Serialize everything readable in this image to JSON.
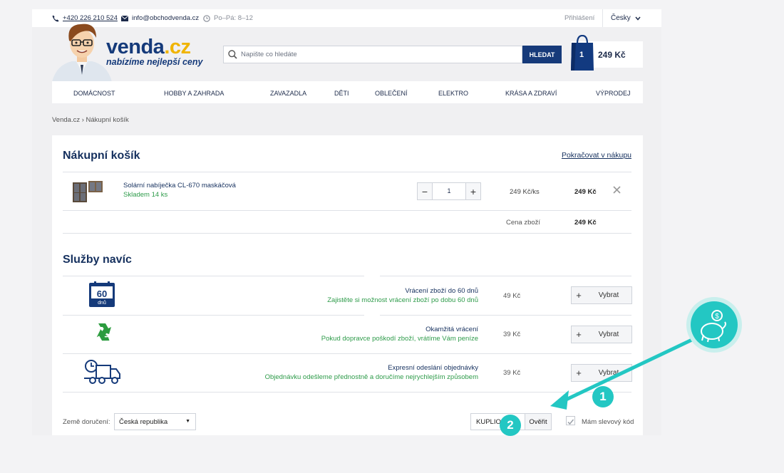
{
  "topbar": {
    "phone": "+420 226 210 524",
    "email": "info@obchodvenda.cz",
    "hours": "Po–Pá: 8–12",
    "login": "Přihlášení",
    "language": "Česky"
  },
  "brand": {
    "name": "venda",
    "tld": ".cz",
    "slogan": "nabízíme nejlepší ceny"
  },
  "search": {
    "placeholder": "Napište co hledáte",
    "button": "HLEDAT"
  },
  "cart": {
    "count": "1",
    "total": "249 Kč"
  },
  "nav": [
    "DOMÁCNOST",
    "HOBBY A ZAHRADA",
    "ZAVAZADLA",
    "DĚTI",
    "OBLEČENÍ",
    "ELEKTRO",
    "KRÁSA A ZDRAVÍ",
    "VÝPRODEJ"
  ],
  "breadcrumb": "Venda.cz › Nákupní košík",
  "basket": {
    "title": "Nákupní košík",
    "continue": "Pokračovat v nákupu",
    "item": {
      "name": "Solární nabíječka CL-670 maskáčová",
      "stock": "Skladem 14 ks",
      "qty": "1",
      "unit_price": "249 Kč/ks",
      "price": "249 Kč"
    },
    "subtotal_label": "Cena zboží",
    "subtotal_value": "249 Kč"
  },
  "services": {
    "title": "Služby navíc",
    "button": "Vybrat",
    "items": [
      {
        "icon": "calendar-60-icon",
        "icon_big": "60",
        "icon_small": "dnů",
        "title": "Vrácení zboží do 60 dnů",
        "desc": "Zajistěte si možnost vrácení zboží po dobu 60 dnů",
        "price": "49 Kč"
      },
      {
        "icon": "recycle-icon",
        "title": "Okamžitá vrácení",
        "desc": "Pokud dopravce poškodí zboží, vrátíme Vám peníze",
        "price": "39 Kč"
      },
      {
        "icon": "delivery-truck-icon",
        "title": "Expresní odeslání objednávky",
        "desc": "Objednávku odešleme přednostně a doručíme nejrychlejším způsobem",
        "price": "39 Kč"
      }
    ]
  },
  "footer": {
    "country_label": "Země doručení:",
    "country": "Česká republika",
    "coupon_value": "KUPLIO",
    "verify": "Ověřit",
    "coupon_checkbox_label": "Mám slevový kód"
  },
  "annotations": {
    "step1": "1",
    "step2": "2",
    "accent": "#23c7c3"
  }
}
